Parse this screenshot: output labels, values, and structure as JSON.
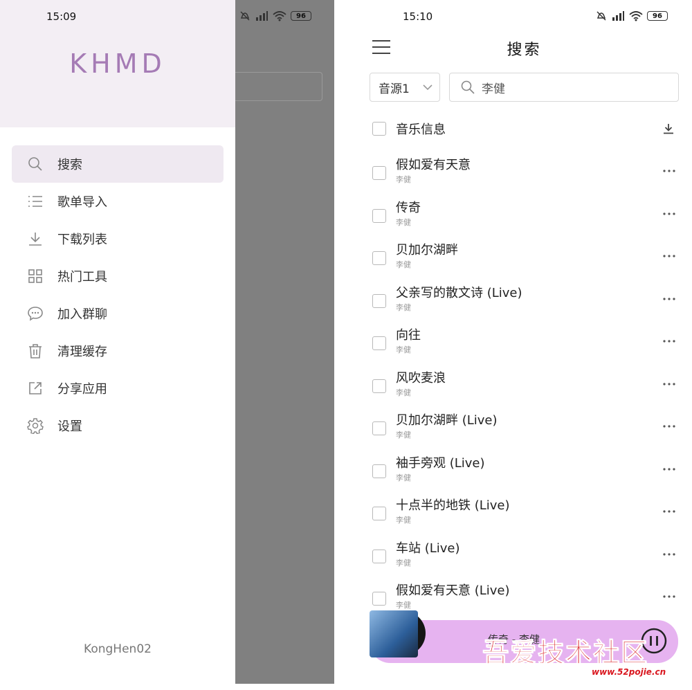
{
  "left": {
    "status": {
      "time": "15:09",
      "battery": "96"
    },
    "brand": "KHMD",
    "menu": [
      {
        "label": "搜索",
        "icon": "search-icon"
      },
      {
        "label": "歌单导入",
        "icon": "list-icon"
      },
      {
        "label": "下载列表",
        "icon": "download-icon"
      },
      {
        "label": "热门工具",
        "icon": "grid-icon"
      },
      {
        "label": "加入群聊",
        "icon": "chat-icon"
      },
      {
        "label": "清理缓存",
        "icon": "trash-icon"
      },
      {
        "label": "分享应用",
        "icon": "share-icon"
      },
      {
        "label": "设置",
        "icon": "gear-icon"
      }
    ],
    "footer": "KongHen02"
  },
  "right": {
    "status": {
      "time": "15:10",
      "battery": "96"
    },
    "title": "搜索",
    "source": "音源1",
    "search_value": "李健",
    "header_label": "音乐信息",
    "songs": [
      {
        "title": "假如爱有天意",
        "artist": "李健"
      },
      {
        "title": "传奇",
        "artist": "李健"
      },
      {
        "title": "贝加尔湖畔",
        "artist": "李健"
      },
      {
        "title": "父亲写的散文诗 (Live)",
        "artist": "李健"
      },
      {
        "title": "向往",
        "artist": "李健"
      },
      {
        "title": "风吹麦浪",
        "artist": "李健"
      },
      {
        "title": "贝加尔湖畔 (Live)",
        "artist": "李健"
      },
      {
        "title": "袖手旁观 (Live)",
        "artist": "李健"
      },
      {
        "title": "十点半的地铁 (Live)",
        "artist": "李健"
      },
      {
        "title": "车站 (Live)",
        "artist": "李健"
      },
      {
        "title": "假如爱有天意 (Live)",
        "artist": "李健"
      }
    ],
    "player_text": "传奇 - 李健"
  },
  "watermark": {
    "text": "吾爱技术社区",
    "url": "www.52pojie.cn"
  },
  "colors": {
    "brand": "#a57bb5",
    "drawer_header": "#f3eef4",
    "player": "#e6b3f0",
    "active_item": "#efe9f1"
  }
}
